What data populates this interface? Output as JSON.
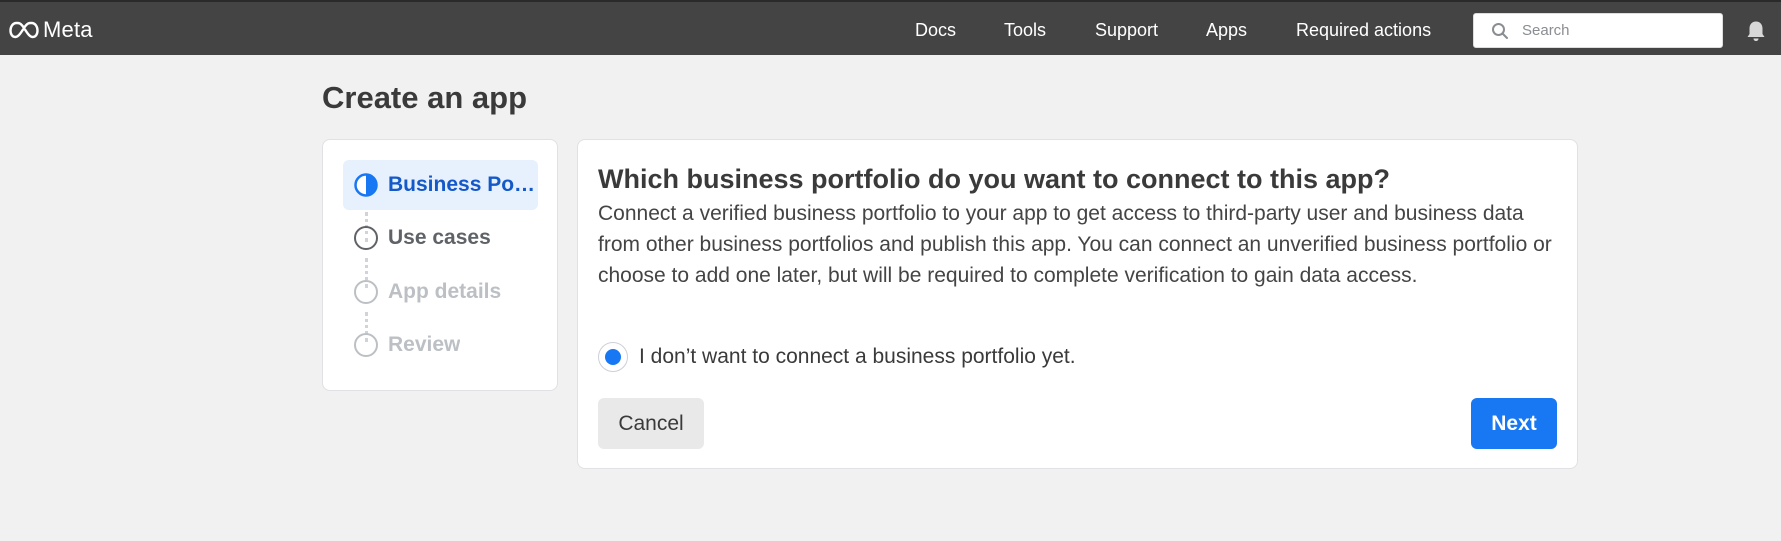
{
  "header": {
    "logo_text": "Meta",
    "nav": [
      {
        "label": "Docs"
      },
      {
        "label": "Tools"
      },
      {
        "label": "Support"
      },
      {
        "label": "Apps"
      },
      {
        "label": "Required actions"
      }
    ],
    "search_placeholder": "Search",
    "icons": [
      "meta-logo-icon",
      "search-icon",
      "bell-icon"
    ]
  },
  "page": {
    "title": "Create an app"
  },
  "steps": [
    {
      "label": "Business Po…",
      "state": "in-progress"
    },
    {
      "label": "Use cases",
      "state": "upcoming"
    },
    {
      "label": "App details",
      "state": "disabled"
    },
    {
      "label": "Review",
      "state": "disabled"
    }
  ],
  "main": {
    "question": "Which business portfolio do you want to connect to this app?",
    "description": "Connect a verified business portfolio to your app to get access to third-party user and business data from other business portfolios and publish this app. You can connect an unverified business portfolio or choose to add one later, but will be required to complete verification to gain data access.",
    "option_label": "I don’t want to connect a business portfolio yet.",
    "option_selected": true,
    "cancel_label": "Cancel",
    "next_label": "Next"
  },
  "colors": {
    "topbar": "#444444",
    "accent": "#1877f2",
    "active_step_bg": "#e7f0fd",
    "active_step_text": "#1459c8"
  }
}
